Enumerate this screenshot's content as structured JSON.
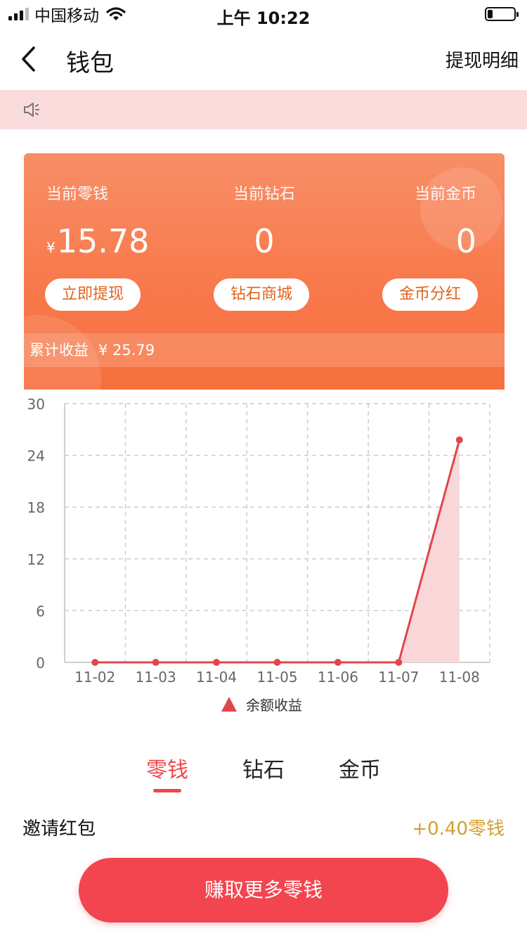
{
  "status_bar": {
    "carrier": "中国移动",
    "time": "上午 10:22",
    "signal_bars_filled": 3,
    "signal_bars_total": 4,
    "battery_level": 0.15
  },
  "nav": {
    "title": "钱包",
    "right_link": "提现明细"
  },
  "wallet": {
    "columns": [
      {
        "label": "当前零钱",
        "currency": "¥",
        "value": "15.78",
        "action": "立即提现"
      },
      {
        "label": "当前钻石",
        "currency": "",
        "value": "0",
        "action": "钻石商城"
      },
      {
        "label": "当前金币",
        "currency": "",
        "value": "0",
        "action": "金币分红"
      }
    ],
    "total_label": "累计收益",
    "total_value": "¥ 25.79"
  },
  "chart_data": {
    "type": "area",
    "x": [
      "11-02",
      "11-03",
      "11-04",
      "11-05",
      "11-06",
      "11-07",
      "11-08"
    ],
    "series": [
      {
        "name": "余额收益",
        "values": [
          0,
          0,
          0,
          0,
          0,
          0,
          25.79
        ]
      }
    ],
    "yticks": [
      0,
      6,
      12,
      18,
      24,
      30
    ],
    "ylim": [
      0,
      30
    ],
    "grid": true,
    "legend": "bottom",
    "colors": {
      "line": "#e0464c",
      "fill": "#f9d6d8",
      "grid": "#cccccc",
      "axis": "#d0d0d0",
      "tick_text": "#666666"
    }
  },
  "tabs": [
    {
      "label": "零钱",
      "active": true
    },
    {
      "label": "钻石",
      "active": false
    },
    {
      "label": "金币",
      "active": false
    }
  ],
  "records": [
    {
      "title": "邀请红包",
      "value": "+0.40零钱"
    }
  ],
  "earn_button": "赚取更多零钱",
  "colors": {
    "accent": "#f3454f",
    "card_start": "#f88e66",
    "card_end": "#f6703e",
    "gold": "#d1a12e",
    "notice_bg": "#fbdcdc"
  }
}
